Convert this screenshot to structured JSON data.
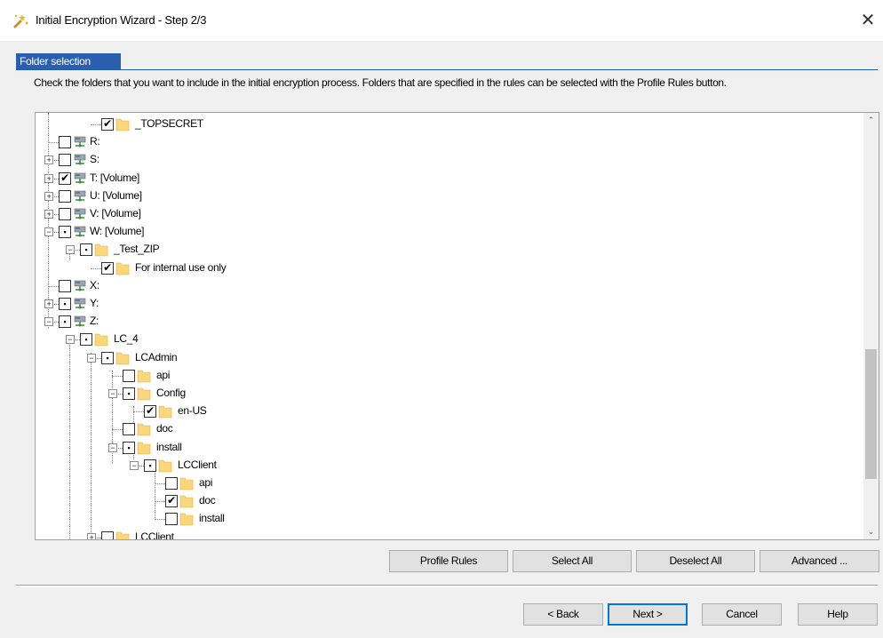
{
  "window": {
    "title": "Initial Encryption Wizard - Step 2/3",
    "close_glyph": "✕"
  },
  "section": {
    "header": "Folder selection",
    "instructions": "Check the folders that you want to include in the initial encryption process. Folders that are specified in the rules can be selected with the Profile Rules button."
  },
  "tree": {
    "items": [
      {
        "label": "_TOPSECRET",
        "state": "checked",
        "icon": "folder-icon",
        "expander": "none"
      },
      {
        "label": "R:",
        "state": "unchecked",
        "icon": "network-drive-icon",
        "expander": "none"
      },
      {
        "label": "S:",
        "state": "unchecked",
        "icon": "network-drive-icon",
        "expander": "plus"
      },
      {
        "label": "T: [Volume]",
        "state": "checked",
        "icon": "network-drive-icon",
        "expander": "plus"
      },
      {
        "label": "U: [Volume]",
        "state": "unchecked",
        "icon": "network-drive-icon",
        "expander": "plus"
      },
      {
        "label": "V: [Volume]",
        "state": "unchecked",
        "icon": "network-drive-icon",
        "expander": "plus"
      },
      {
        "label": "W: [Volume]",
        "state": "partial",
        "icon": "network-drive-icon",
        "expander": "minus"
      },
      {
        "label": "_Test_ZIP",
        "state": "partial",
        "icon": "folder-icon",
        "expander": "minus"
      },
      {
        "label": "For internal use only",
        "state": "checked",
        "icon": "folder-icon",
        "expander": "none"
      },
      {
        "label": "X:",
        "state": "unchecked",
        "icon": "network-drive-icon",
        "expander": "none"
      },
      {
        "label": "Y:",
        "state": "partial",
        "icon": "network-drive-icon",
        "expander": "plus"
      },
      {
        "label": "Z:",
        "state": "partial",
        "icon": "network-drive-icon",
        "expander": "minus"
      },
      {
        "label": "LC_4",
        "state": "partial",
        "icon": "folder-icon",
        "expander": "minus"
      },
      {
        "label": "LCAdmin",
        "state": "partial",
        "icon": "folder-icon",
        "expander": "minus"
      },
      {
        "label": "api",
        "state": "unchecked",
        "icon": "folder-icon",
        "expander": "none"
      },
      {
        "label": "Config",
        "state": "partial",
        "icon": "folder-icon",
        "expander": "minus"
      },
      {
        "label": "en-US",
        "state": "checked",
        "icon": "folder-icon",
        "expander": "none"
      },
      {
        "label": "doc",
        "state": "unchecked",
        "icon": "folder-icon",
        "expander": "none"
      },
      {
        "label": "install",
        "state": "partial",
        "icon": "folder-icon",
        "expander": "minus"
      },
      {
        "label": "LCClient",
        "state": "partial",
        "icon": "folder-icon",
        "expander": "minus"
      },
      {
        "label": "api",
        "state": "unchecked",
        "icon": "folder-icon",
        "expander": "none"
      },
      {
        "label": "doc",
        "state": "checked",
        "icon": "folder-icon",
        "expander": "none"
      },
      {
        "label": "install",
        "state": "unchecked",
        "icon": "folder-icon",
        "expander": "none"
      },
      {
        "label": "LCClient",
        "state": "unchecked",
        "icon": "folder-icon",
        "expander": "plus"
      }
    ],
    "glyphs": {
      "checked": "✔",
      "partial": "▪",
      "unchecked": "",
      "plus": "+",
      "minus": "−",
      "none": ""
    }
  },
  "scrollbar": {
    "up_glyph": "⌃",
    "down_glyph": "⌄"
  },
  "actions": {
    "profile_rules": "Profile Rules",
    "select_all": "Select All",
    "deselect_all": "Deselect All",
    "advanced": "Advanced ..."
  },
  "nav": {
    "back": "< Back",
    "next": "Next >",
    "cancel": "Cancel",
    "help": "Help"
  },
  "colors": {
    "folder": "#f9d77a",
    "section_header": "#2a5fb0"
  }
}
